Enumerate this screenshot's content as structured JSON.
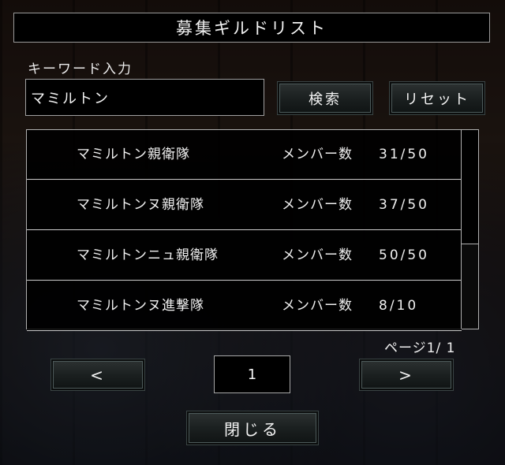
{
  "dialog": {
    "title": "募集ギルドリスト"
  },
  "search": {
    "label": "キーワード入力",
    "value": "マミルトン",
    "search_button": "検索",
    "reset_button": "リセット"
  },
  "guilds": [
    {
      "name": "マミルトン親衛隊",
      "members_label": "メンバー数",
      "members": "31/50"
    },
    {
      "name": "マミルトンヌ親衛隊",
      "members_label": "メンバー数",
      "members": "37/50"
    },
    {
      "name": "マミルトンニュ親衛隊",
      "members_label": "メンバー数",
      "members": "50/50"
    },
    {
      "name": "マミルトンヌ進撃隊",
      "members_label": "メンバー数",
      "members": "8/10"
    }
  ],
  "pagination": {
    "indicator": "ページ1/ 1",
    "prev_label": "<",
    "next_label": ">",
    "current_page": "1"
  },
  "footer": {
    "close_button": "閉じる"
  },
  "colors": {
    "panel_bg": "#000000",
    "panel_border": "#a0a0a0",
    "button_face": "#1b2020",
    "text": "#f0f0f0"
  }
}
